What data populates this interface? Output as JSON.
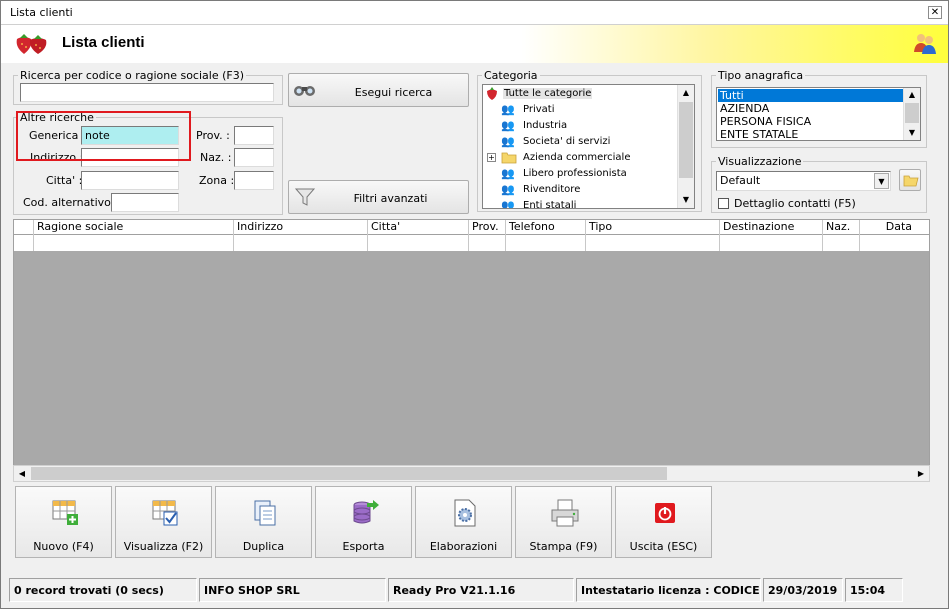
{
  "window": {
    "title": "Lista clienti",
    "header_title": "Lista clienti"
  },
  "search": {
    "group_label": "Ricerca per codice o ragione sociale (F3)",
    "value": "",
    "search_button": "Esegui ricerca",
    "filters_button": "Filtri avanzati"
  },
  "other": {
    "group_label": "Altre ricerche",
    "generica_label": "Generica :",
    "generica_value": "note",
    "indirizzo_label": "Indirizzo :",
    "citta_label": "Citta' :",
    "cod_label": "Cod. alternativo :",
    "prov_label": "Prov. :",
    "naz_label": "Naz. :",
    "zona_label": "Zona :"
  },
  "category": {
    "group_label": "Categoria",
    "items": [
      "Tutte le categorie",
      "Privati",
      "Industria",
      "Societa' di servizi",
      "Azienda commerciale",
      "Libero professionista",
      "Rivenditore",
      "Enti statali"
    ]
  },
  "tipo": {
    "group_label": "Tipo anagrafica",
    "items": [
      "Tutti",
      "AZIENDA",
      "PERSONA FISICA",
      "ENTE STATALE"
    ],
    "selected_index": 0
  },
  "visual": {
    "group_label": "Visualizzazione",
    "selected": "Default",
    "detail_label": "Dettaglio contatti (F5)"
  },
  "grid": {
    "columns": [
      "Ragione sociale",
      "Indirizzo",
      "Citta'",
      "Prov.",
      "Telefono",
      "Tipo",
      "Destinazione",
      "Naz.",
      "Data"
    ]
  },
  "toolbar": {
    "new": "Nuovo (F4)",
    "view": "Visualizza (F2)",
    "dup": "Duplica",
    "export": "Esporta",
    "process": "Elaborazioni",
    "print": "Stampa (F9)",
    "exit": "Uscita (ESC)"
  },
  "status": {
    "records": "0 record trovati (0 secs)",
    "company": "INFO SHOP SRL",
    "version": "Ready Pro V21.1.16",
    "license": "Intestatario licenza : CODICE SRL",
    "date": "29/03/2019",
    "time": "15:04"
  },
  "colors": {
    "highlight": "#e0191e",
    "selection": "#0078d7",
    "grid_body": "#a9a9a9",
    "header_yellow": "#ffff3c"
  }
}
